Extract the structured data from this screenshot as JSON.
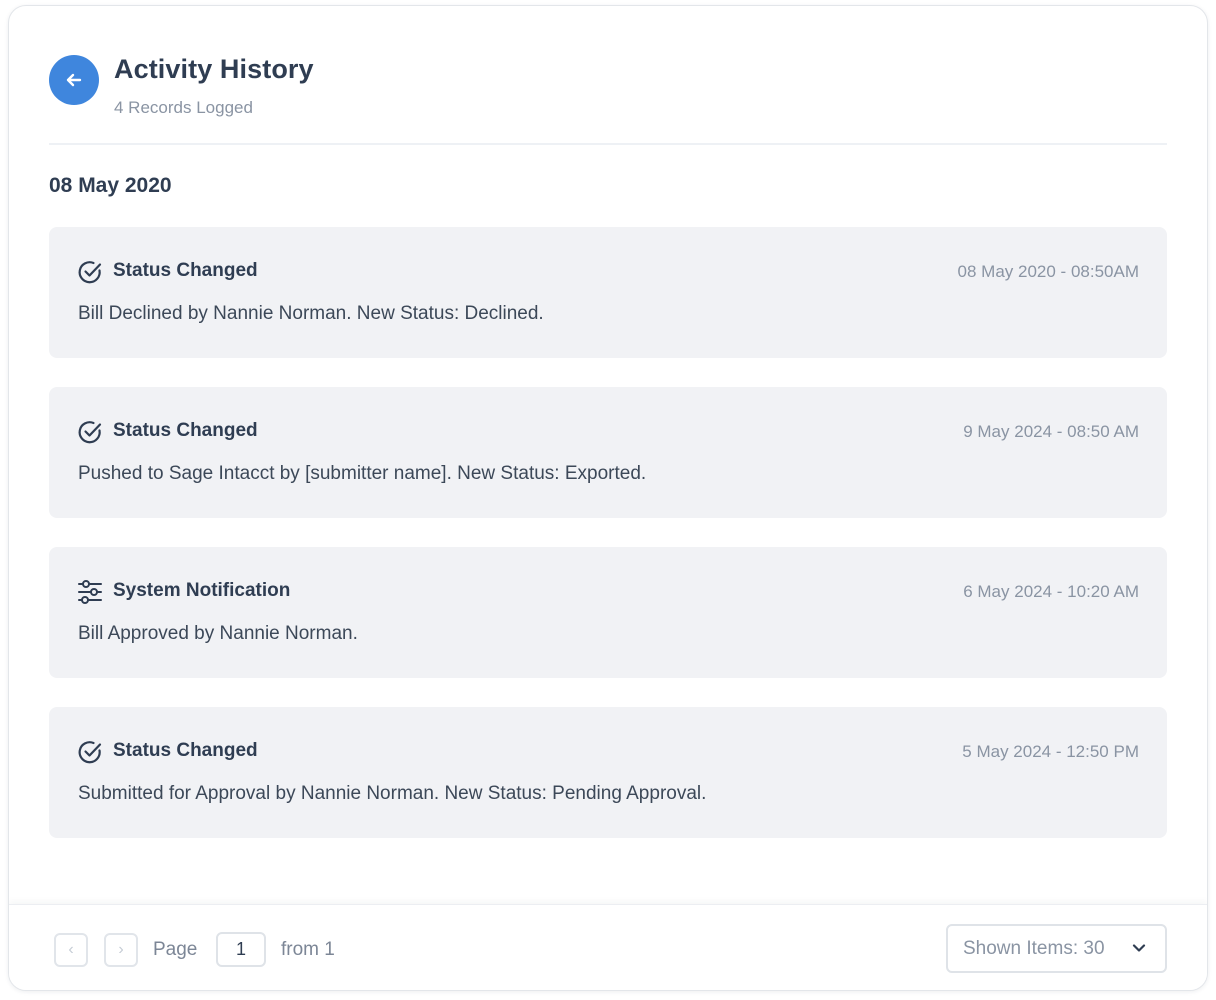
{
  "header": {
    "title": "Activity History",
    "subtitle": "4 Records Logged",
    "back_icon": "arrow-left-icon"
  },
  "date_heading": "08 May 2020",
  "activities": [
    {
      "icon": "check-circle-icon",
      "title": "Status Changed",
      "time": "08 May 2020 - 08:50AM",
      "description": "Bill Declined by Nannie Norman. New Status: Declined."
    },
    {
      "icon": "check-circle-icon",
      "title": "Status Changed",
      "time": "9 May 2024 - 08:50 AM",
      "description": "Pushed to Sage Intacct by [submitter name]. New Status: Exported."
    },
    {
      "icon": "sliders-icon",
      "title": "System Notification",
      "time": "6 May 2024 - 10:20 AM",
      "description": "Bill Approved by Nannie Norman."
    },
    {
      "icon": "check-circle-icon",
      "title": "Status Changed",
      "time": "5 May 2024 - 12:50 PM",
      "description": "Submitted for Approval by Nannie Norman. New Status: Pending Approval."
    }
  ],
  "pagination": {
    "page_label": "Page",
    "current_page": "1",
    "from_label": "from 1",
    "prev_glyph": "‹",
    "next_glyph": "›",
    "shown_items": "Shown Items: 30"
  },
  "colors": {
    "accent": "#3f86dd",
    "card_bg": "#f1f2f5",
    "text_primary": "#2f3d52",
    "text_muted": "#8a94a3"
  }
}
